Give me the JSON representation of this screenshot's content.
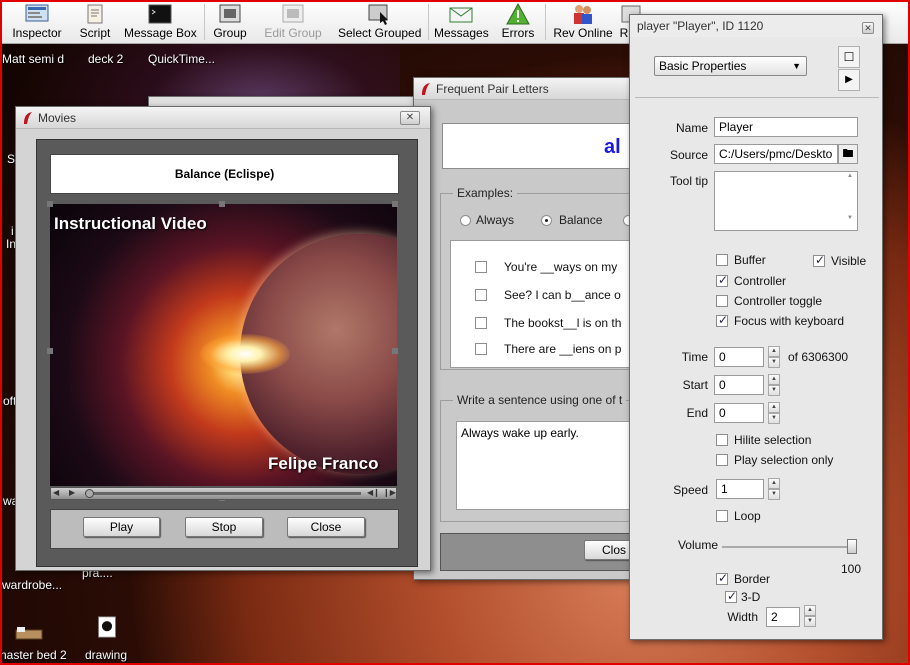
{
  "toolbar": {
    "items": [
      {
        "label": "Inspector",
        "icon": "inspector-icon"
      },
      {
        "label": "Script",
        "icon": "script-icon"
      },
      {
        "label": "Message Box",
        "icon": "message-box-icon"
      },
      {
        "label": "Group",
        "icon": "group-icon"
      },
      {
        "label": "Edit Group",
        "icon": "edit-group-icon",
        "disabled": true
      },
      {
        "label": "Select Grouped",
        "icon": "select-grouped-icon"
      },
      {
        "label": "Messages",
        "icon": "messages-icon"
      },
      {
        "label": "Errors",
        "icon": "errors-icon"
      },
      {
        "label": "Rev Online",
        "icon": "rev-online-icon"
      },
      {
        "label": "R",
        "icon": "resources-icon"
      }
    ]
  },
  "desktop": {
    "top_labels": [
      "Matt semi d",
      "deck 2",
      "QuickTime..."
    ],
    "bottom_labels": [
      "wardrobe...",
      "naster bed 2",
      "drawing"
    ],
    "left_fragments": [
      "Sp",
      "i",
      "In",
      "oft",
      "wa"
    ],
    "partial_label": "pra...."
  },
  "fpl_window": {
    "title": "Frequent Pair Letters",
    "big_text": "al",
    "examples_label": "Examples:",
    "radios": [
      {
        "label": "Always",
        "selected": false
      },
      {
        "label": "Balance",
        "selected": true
      }
    ],
    "sentences": [
      "You're __ways on my",
      "See? I can b__ance o",
      "The bookst__l is on th",
      "There are __iens on p"
    ],
    "write_label": "Write a sentence using one of t",
    "answer": "Always wake up early.",
    "close_label": "Clos"
  },
  "movies_window": {
    "title": "Movies",
    "video_title": "Balance (Eclispe)",
    "overlay_top": "Instructional Video",
    "overlay_bottom": "Felipe Franco",
    "buttons": {
      "play": "Play",
      "stop": "Stop",
      "close": "Close"
    }
  },
  "inspector": {
    "title": "player \"Player\", ID 1120",
    "panel_select": "Basic Properties",
    "labels": {
      "name": "Name",
      "source": "Source",
      "tooltip": "Tool tip",
      "time": "Time",
      "start": "Start",
      "end": "End",
      "of": "of 6306300",
      "speed": "Speed",
      "volume": "Volume",
      "width": "Width"
    },
    "name_value": "Player",
    "source_value": "C:/Users/pmc/Deskto",
    "tooltip_value": "",
    "checkboxes": {
      "buffer": {
        "label": "Buffer",
        "checked": false
      },
      "visible": {
        "label": "Visible",
        "checked": true
      },
      "controller": {
        "label": "Controller",
        "checked": true
      },
      "controller_toggle": {
        "label": "Controller toggle",
        "checked": false
      },
      "focus": {
        "label": "Focus with keyboard",
        "checked": true
      },
      "hilite": {
        "label": "Hilite selection",
        "checked": false
      },
      "play_selection": {
        "label": "Play selection only",
        "checked": false
      },
      "loop": {
        "label": "Loop",
        "checked": false
      },
      "border": {
        "label": "Border",
        "checked": true
      },
      "three_d": {
        "label": "3-D",
        "checked": true
      }
    },
    "time_value": "0",
    "start_value": "0",
    "end_value": "0",
    "speed_value": "1",
    "volume_value": "100",
    "width_value": "2"
  }
}
